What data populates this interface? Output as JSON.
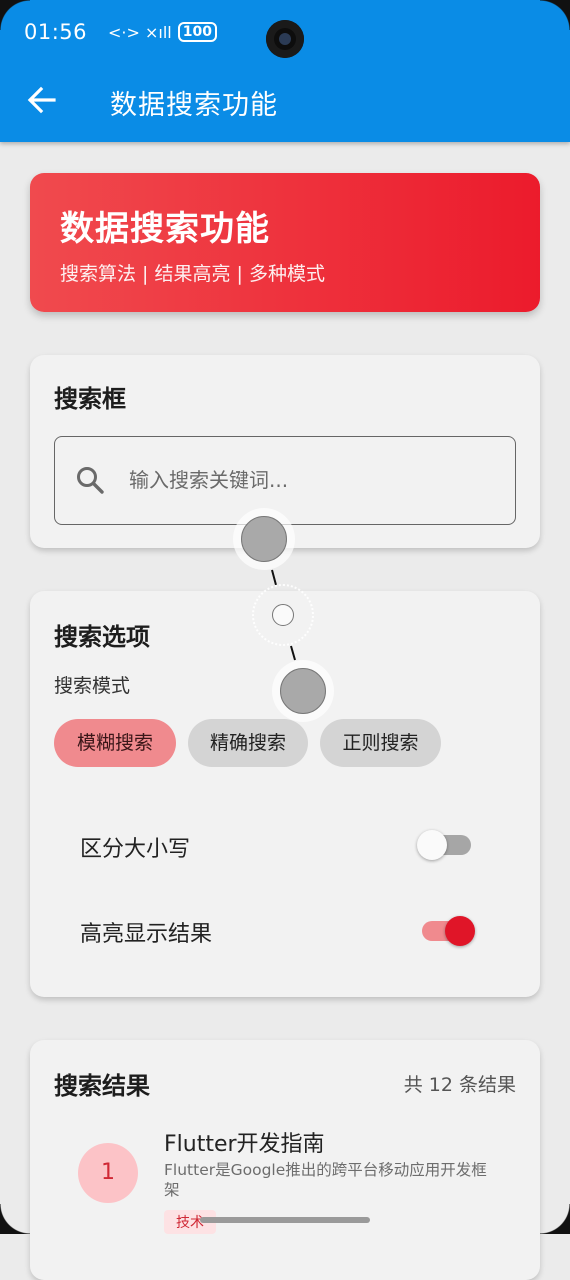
{
  "status_bar": {
    "time": "01:56",
    "network_glyphs": "<·> ×ıll",
    "battery": "100"
  },
  "app_bar": {
    "title": "数据搜索功能",
    "back_icon": "arrow-left-icon"
  },
  "hero": {
    "title": "数据搜索功能",
    "subtitle": "搜索算法 | 结果高亮 | 多种模式"
  },
  "search_card": {
    "title": "搜索框",
    "placeholder": "输入搜索关键词..."
  },
  "options_card": {
    "title": "搜索选项",
    "mode_label": "搜索模式",
    "modes": [
      {
        "label": "模糊搜索",
        "selected": true
      },
      {
        "label": "精确搜索",
        "selected": false
      },
      {
        "label": "正则搜索",
        "selected": false
      }
    ],
    "case_sensitive": {
      "label": "区分大小写",
      "on": false
    },
    "highlight": {
      "label": "高亮显示结果",
      "on": true
    }
  },
  "results_card": {
    "title": "搜索结果",
    "count_text": "共 12 条结果",
    "items": [
      {
        "index": "1",
        "title": "Flutter开发指南",
        "description": "Flutter是Google推出的跨平台移动应用开发框架",
        "tag": "技术"
      }
    ]
  },
  "colors": {
    "app_bar": "#0a8ce6",
    "accent_red": "#e21b2c",
    "chip_selected": "#f08a8e"
  }
}
